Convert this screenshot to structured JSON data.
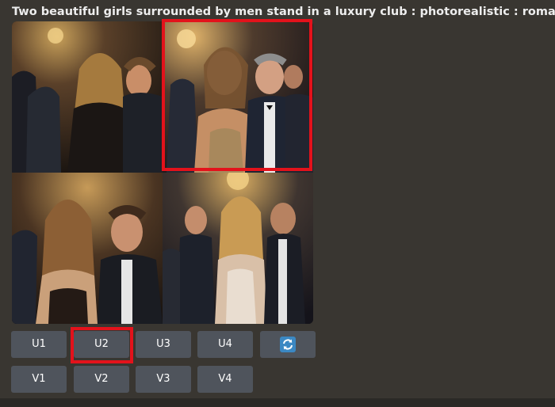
{
  "prompt": {
    "text": "Two beautiful girls surrounded by men stand in a luxury club : photorealistic : romantic. -"
  },
  "image_grid": {
    "tiles": [
      "image-1",
      "image-2",
      "image-3",
      "image-4"
    ],
    "highlighted_tile": 2
  },
  "buttons": {
    "upscale": [
      "U1",
      "U2",
      "U3",
      "U4"
    ],
    "variation": [
      "V1",
      "V2",
      "V3",
      "V4"
    ],
    "reroll_icon": "refresh-icon",
    "highlighted_button": "U2"
  },
  "colors": {
    "background": "#393631",
    "button": "#4f545c",
    "button_text": "#ffffff",
    "highlight": "#e3121b",
    "refresh_icon": "#3b88c3"
  }
}
